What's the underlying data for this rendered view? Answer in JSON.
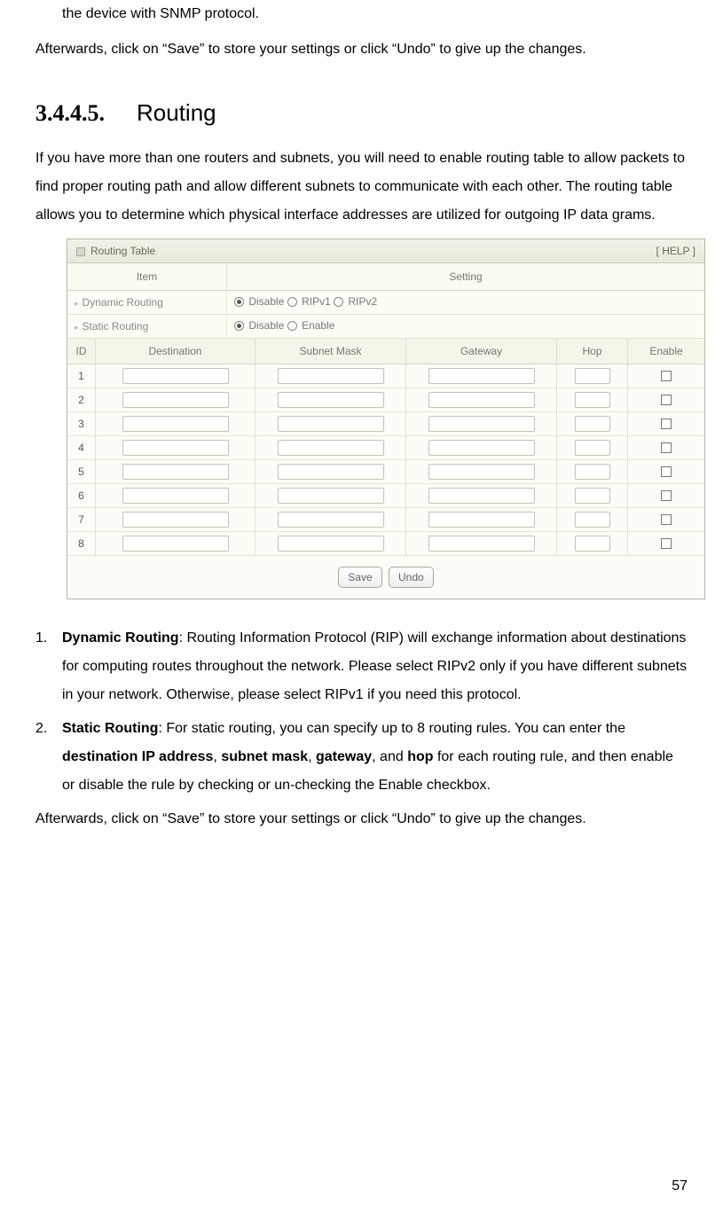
{
  "text": {
    "snmp_trailing": "the device with SNMP protocol.",
    "afterwards_1": "Afterwards, click on “Save” to store your settings or click “Undo” to give up the changes.",
    "heading_num": "3.4.4.5.",
    "heading_title": "Routing",
    "intro": "If you have more than one routers and subnets, you will need to enable routing table to allow packets to find proper routing path and allow different subnets to communicate with each other. The routing table allows you to determine which physical interface addresses are utilized for outgoing IP data grams.",
    "afterwards_2": "Afterwards, click on “Save” to store your settings or click “Undo” to give up the changes.",
    "pagenum": "57"
  },
  "screenshot": {
    "title": "Routing Table",
    "help": "[ HELP ]",
    "header_item": "Item",
    "header_setting": "Setting",
    "dynamic_label": "Dynamic Routing",
    "static_label": "Static Routing",
    "radios_dynamic": [
      {
        "label": "Disable",
        "checked": true
      },
      {
        "label": "RIPv1",
        "checked": false
      },
      {
        "label": "RIPv2",
        "checked": false
      }
    ],
    "radios_static": [
      {
        "label": "Disable",
        "checked": true
      },
      {
        "label": "Enable",
        "checked": false
      }
    ],
    "cols": {
      "id": "ID",
      "dest": "Destination",
      "mask": "Subnet Mask",
      "gw": "Gateway",
      "hop": "Hop",
      "en": "Enable"
    },
    "row_ids": [
      "1",
      "2",
      "3",
      "4",
      "5",
      "6",
      "7",
      "8"
    ],
    "btn_save": "Save",
    "btn_undo": "Undo"
  },
  "list": {
    "item1_num": "1.",
    "item1_bold": "Dynamic Routing",
    "item1_body": ": Routing Information Protocol (RIP) will exchange information about destinations for computing routes throughout the network. Please select RIPv2 only if you have different subnets in your network. Otherwise, please select RIPv1 if you need this protocol.",
    "item2_num": "2.",
    "item2_bold": "Static Routing",
    "item2_body_a": ": For static routing, you can specify up to 8 routing rules. You can enter the ",
    "item2_body_b": "destination IP address",
    "item2_body_c": ", ",
    "item2_body_d": "subnet mask",
    "item2_body_e": ", ",
    "item2_body_f": "gateway",
    "item2_body_g": ", and ",
    "item2_body_h": "hop",
    "item2_body_i": " for each routing rule, and then enable or disable the rule by checking or un-checking the Enable checkbox."
  }
}
